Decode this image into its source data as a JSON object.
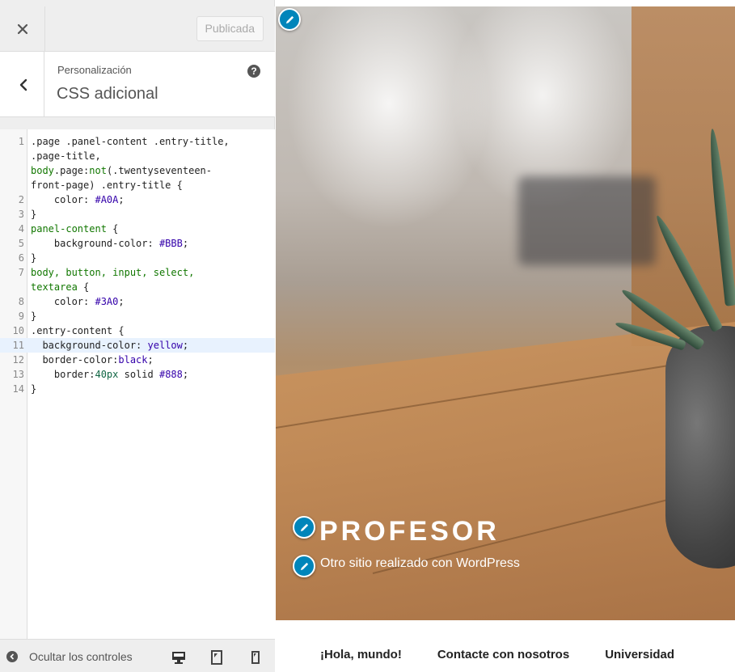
{
  "topbar": {
    "publish_label": "Publicada"
  },
  "section": {
    "breadcrumb": "Personalización",
    "title": "CSS adicional",
    "help": "?"
  },
  "editor": {
    "active_line": 11,
    "lines": [
      {
        "num": "1",
        "tokens": [
          {
            "t": ".page .panel-content .entry-title,",
            "c": "sel"
          }
        ]
      },
      {
        "num": "",
        "tokens": [
          {
            "t": ".page-title,",
            "c": "sel"
          }
        ]
      },
      {
        "num": "",
        "tokens": [
          {
            "t": "body",
            "c": "tag"
          },
          {
            "t": ".page:",
            "c": "sel"
          },
          {
            "t": "not",
            "c": "tag"
          },
          {
            "t": "(.twentyseventeen-",
            "c": "sel"
          }
        ]
      },
      {
        "num": "",
        "tokens": [
          {
            "t": "front-page) .entry-title {",
            "c": "sel"
          }
        ]
      },
      {
        "num": "2",
        "tokens": [
          {
            "t": "    color: ",
            "c": "prop"
          },
          {
            "t": "#A0A",
            "c": "val"
          },
          {
            "t": ";",
            "c": "plain"
          }
        ]
      },
      {
        "num": "3",
        "tokens": [
          {
            "t": "}",
            "c": "plain"
          }
        ]
      },
      {
        "num": "4",
        "tokens": [
          {
            "t": "panel-content",
            "c": "tag"
          },
          {
            "t": " {",
            "c": "plain"
          }
        ]
      },
      {
        "num": "5",
        "tokens": [
          {
            "t": "    background-color: ",
            "c": "prop"
          },
          {
            "t": "#BBB",
            "c": "val"
          },
          {
            "t": ";",
            "c": "plain"
          }
        ]
      },
      {
        "num": "6",
        "tokens": [
          {
            "t": "}",
            "c": "plain"
          }
        ]
      },
      {
        "num": "7",
        "tokens": [
          {
            "t": "body, button, input, select,",
            "c": "tag"
          }
        ]
      },
      {
        "num": "",
        "tokens": [
          {
            "t": "textarea",
            "c": "tag"
          },
          {
            "t": " {",
            "c": "plain"
          }
        ]
      },
      {
        "num": "8",
        "tokens": [
          {
            "t": "    color: ",
            "c": "prop"
          },
          {
            "t": "#3A0",
            "c": "val"
          },
          {
            "t": ";",
            "c": "plain"
          }
        ]
      },
      {
        "num": "9",
        "tokens": [
          {
            "t": "}",
            "c": "plain"
          }
        ]
      },
      {
        "num": "10",
        "tokens": [
          {
            "t": ".entry-content {",
            "c": "sel"
          }
        ]
      },
      {
        "num": "11",
        "tokens": [
          {
            "t": "  background-color: ",
            "c": "prop"
          },
          {
            "t": "yellow",
            "c": "val"
          },
          {
            "t": ";",
            "c": "plain"
          }
        ]
      },
      {
        "num": "12",
        "tokens": [
          {
            "t": "  border-color:",
            "c": "prop"
          },
          {
            "t": "black",
            "c": "val"
          },
          {
            "t": ";",
            "c": "plain"
          }
        ]
      },
      {
        "num": "13",
        "tokens": [
          {
            "t": "    border:",
            "c": "prop"
          },
          {
            "t": "40px",
            "c": "num"
          },
          {
            "t": " solid ",
            "c": "prop"
          },
          {
            "t": "#888",
            "c": "val"
          },
          {
            "t": ";",
            "c": "plain"
          }
        ]
      },
      {
        "num": "14",
        "tokens": [
          {
            "t": "}",
            "c": "plain"
          }
        ]
      }
    ]
  },
  "footer": {
    "hide_controls_label": "Ocultar los controles"
  },
  "preview": {
    "site_title": "PROFESOR",
    "site_description": "Otro sitio realizado con WordPress",
    "nav": [
      "¡Hola, mundo!",
      "Contacte con nosotros",
      "Universidad"
    ]
  },
  "icons": {
    "close": "close-icon",
    "back": "chevron-left-icon",
    "help": "help-icon",
    "hide": "arrow-left-circle-icon",
    "desktop": "desktop-icon",
    "tablet": "tablet-icon",
    "mobile": "mobile-icon",
    "edit": "pencil-icon"
  },
  "colors": {
    "accent": "#0085ba",
    "panel_bg": "#eeeeee",
    "active_line": "#e8f2fe"
  }
}
